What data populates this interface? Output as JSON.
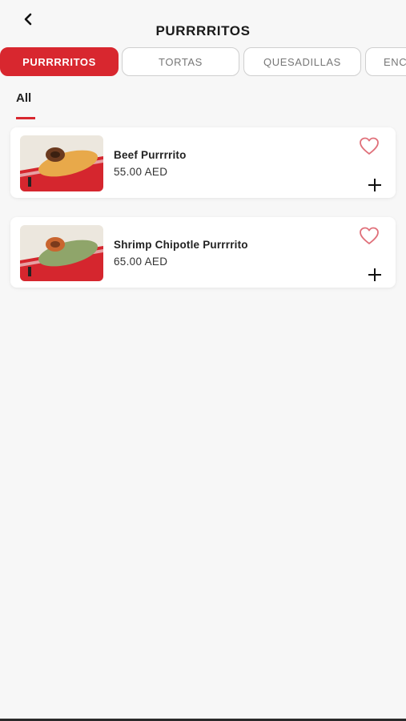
{
  "header": {
    "title": "PURRRRITOS",
    "back_icon": "chevron-left-icon"
  },
  "categories": [
    {
      "label": "PURRRRITOS",
      "active": true
    },
    {
      "label": "TORTAS",
      "active": false
    },
    {
      "label": "QUESADILLAS",
      "active": false
    },
    {
      "label": "ENC",
      "active": false
    }
  ],
  "filter": {
    "label": "All"
  },
  "items": [
    {
      "name": "Beef Purrrrito",
      "price": "55.00 AED",
      "wrap_color": "#e8a94a",
      "favorite_icon": "heart-outline-icon",
      "add_icon": "plus-icon"
    },
    {
      "name": "Shrimp Chipotle Purrrrito",
      "price": "65.00 AED",
      "wrap_color": "#8fa56a",
      "favorite_icon": "heart-outline-icon",
      "add_icon": "plus-icon"
    }
  ],
  "colors": {
    "accent": "#d8272f",
    "background": "#f7f7f7",
    "heart": "#e0707a"
  }
}
